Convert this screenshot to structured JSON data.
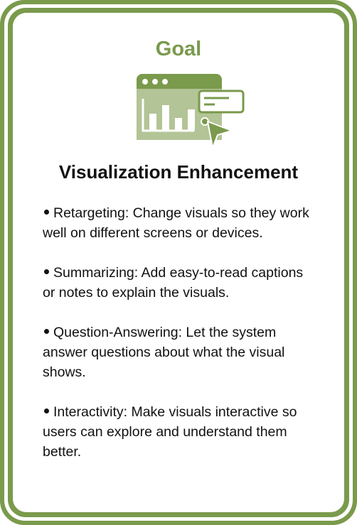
{
  "card": {
    "goal_label": "Goal",
    "heading": "Visualization Enhancement",
    "accent_color": "#7a9a4c",
    "icon": "dashboard-window-with-cursor-icon"
  },
  "bullets": [
    {
      "text": "Retargeting: Change visuals so they work well on different screens or devices."
    },
    {
      "text": "Summarizing: Add easy-to-read captions or notes to explain the visuals."
    },
    {
      "text": "Question-Answering: Let the system answer questions about what the visual shows."
    },
    {
      "text": "Interactivity: Make visuals interactive so users can explore and understand them better."
    }
  ]
}
